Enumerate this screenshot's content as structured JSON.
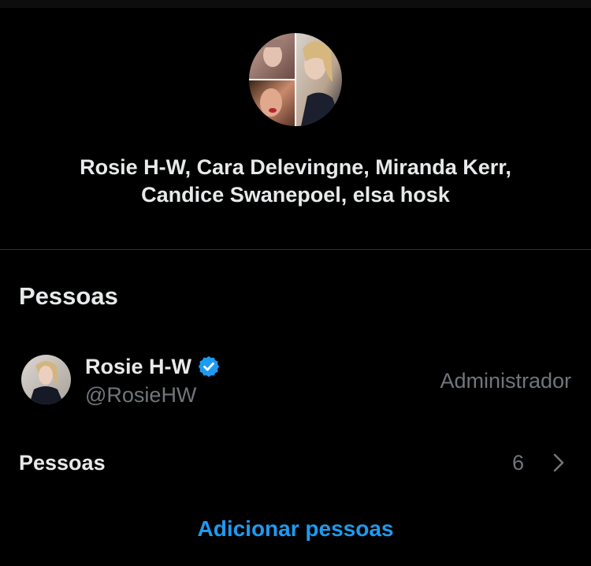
{
  "group": {
    "name_line1": "Rosie H-W, Cara Delevingne, Miranda Kerr,",
    "name_line2": "Candice Swanepoel, elsa hosk",
    "avatar_icon": "group-avatar-collage"
  },
  "people_section": {
    "title": "Pessoas",
    "members": [
      {
        "name": "Rosie H-W",
        "handle": "@RosieHW",
        "role": "Administrador",
        "verified": true,
        "avatar_icon": "profile-photo"
      }
    ],
    "people_row": {
      "label": "Pessoas",
      "count": "6",
      "icon": "chevron-right-icon"
    },
    "add_label": "Adicionar pessoas"
  },
  "colors": {
    "background": "#000000",
    "primary_text": "#e7e9ea",
    "secondary_text": "#71767b",
    "accent": "#1d9bf0",
    "divider": "#2f3336"
  }
}
